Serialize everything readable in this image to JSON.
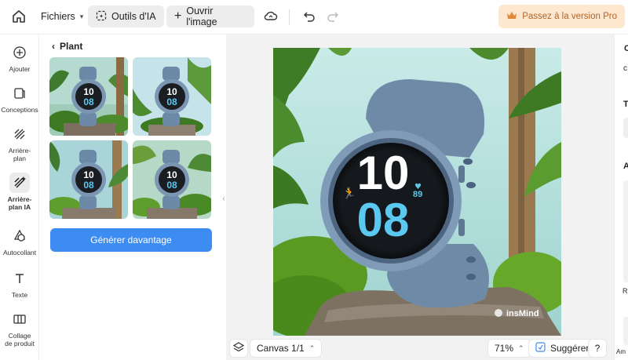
{
  "topbar": {
    "files_label": "Fichiers",
    "ai_tools_label": "Outils d'IA",
    "open_image_label": "Ouvrir l'image",
    "pro_label": "Passez à la version Pro"
  },
  "rail": {
    "items": [
      {
        "label": "Ajouter",
        "icon": "plus-circle-icon"
      },
      {
        "label": "Conceptions",
        "icon": "templates-icon"
      },
      {
        "label": "Arrière-plan",
        "icon": "hatch-icon"
      },
      {
        "label": "Arrière-plan IA",
        "icon": "ai-background-icon"
      },
      {
        "label": "Autocollant",
        "icon": "sticker-icon"
      },
      {
        "label": "Texte",
        "icon": "text-icon"
      },
      {
        "label": "Collage de produit",
        "icon": "collage-icon"
      }
    ]
  },
  "panel": {
    "back_label": "Plant",
    "thumb_time_h": "10",
    "thumb_time_m": "08",
    "generate_label": "Générer davantage"
  },
  "canvas": {
    "watch_hour": "10",
    "watch_min": "08",
    "heart_value": "89",
    "watermark": "insMind"
  },
  "bottom": {
    "canvas_label": "Canvas 1/1",
    "zoom": "71%",
    "suggest_label": "Suggérer",
    "help_label": "?"
  },
  "right_panel": {
    "letters": [
      "C",
      "c",
      "T",
      "A",
      "Ra",
      "Am"
    ]
  },
  "colors": {
    "accent": "#3d8cf2",
    "pro_bg": "#fde8cf",
    "pro_text": "#b0652a",
    "digits": "#5bc8f0"
  }
}
